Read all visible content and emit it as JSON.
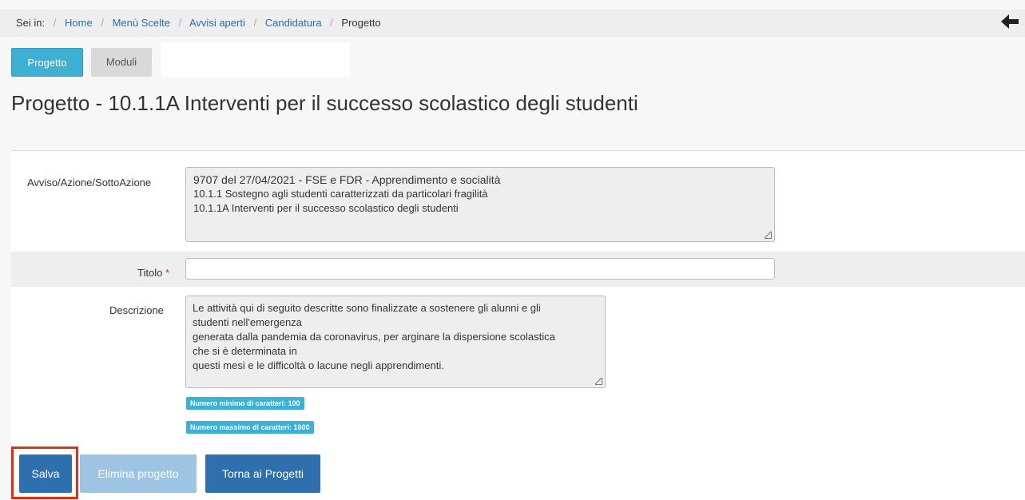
{
  "breadcrumb": {
    "prefix": "Sei in:",
    "items": [
      {
        "label": "Home"
      },
      {
        "label": "Menù Scelte"
      },
      {
        "label": "Avvisi aperti"
      },
      {
        "label": "Candidatura"
      },
      {
        "label": "Progetto"
      }
    ]
  },
  "tabs": [
    {
      "label": "Progetto",
      "active": true
    },
    {
      "label": "Moduli",
      "active": false
    }
  ],
  "page_title": "Progetto - 10.1.1A Interventi per il successo scolastico degli studenti",
  "form": {
    "avviso": {
      "label": "Avviso/Azione/SottoAzione",
      "line1": "9707 del 27/04/2021 - FSE e FDR - Apprendimento e socialità",
      "line2": "10.1.1  Sostegno agli studenti caratterizzati da particolari fragilità",
      "line3": "10.1.1A Interventi per il successo scolastico degli studenti"
    },
    "titolo": {
      "label": "Titolo",
      "required_mark": "*",
      "value": ""
    },
    "descrizione": {
      "label": "Descrizione",
      "lines": [
        "Le attività qui di seguito descritte sono finalizzate a sostenere gli alunni e gli",
        "studenti nell'emergenza",
        "generata dalla pandemia da coronavirus, per arginare la dispersione scolastica",
        "che si è determinata in",
        "questi mesi e le difficoltà o lacune negli apprendimenti."
      ],
      "min_hint": "Numero minimo di caratteri: 100",
      "max_hint": "Numero massimo di caratteri: 1800"
    }
  },
  "buttons": {
    "save": "Salva",
    "delete": "Elimina progetto",
    "back": "Torna ai Progetti"
  },
  "colors": {
    "accent": "#3eb0d4",
    "primary_button": "#2e6fae",
    "highlight_frame": "#ee2b12",
    "link": "#2a6cb0"
  },
  "icons": {
    "back": "arrow-left-icon"
  }
}
